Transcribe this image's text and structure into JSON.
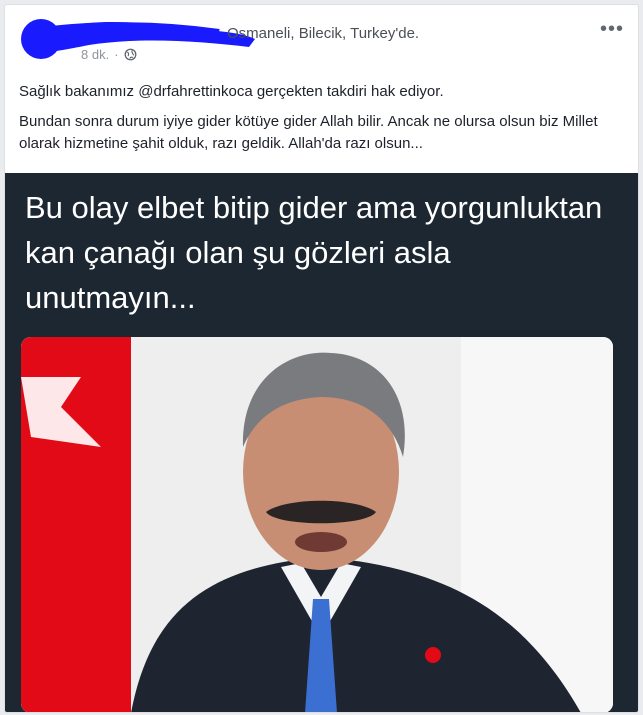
{
  "post": {
    "location_text": "Osmaneli, Bilecik, Turkey'de.",
    "time": "8 dk.",
    "privacy_icon": "globe-icon",
    "more_icon": "more-options-icon",
    "paragraphs": [
      "Sağlık bakanımız @drfahrettinkoca gerçekten takdiri hak ediyor.",
      "Bundan sonra durum iyiye gider kötüye gider Allah bilir. Ancak ne olursa olsun biz Millet olarak hizmetine şahit olduk, razı geldik. Allah'da razı olsun..."
    ]
  },
  "image": {
    "caption": "Bu olay elbet bitip gider ama yorgunluktan kan çanağı olan şu gözleri asla unutmayın...",
    "background": "#1d2731"
  },
  "colors": {
    "redaction": "#1a1aff",
    "flag_red": "#e30a17",
    "link_gray": "#4b4f56"
  }
}
